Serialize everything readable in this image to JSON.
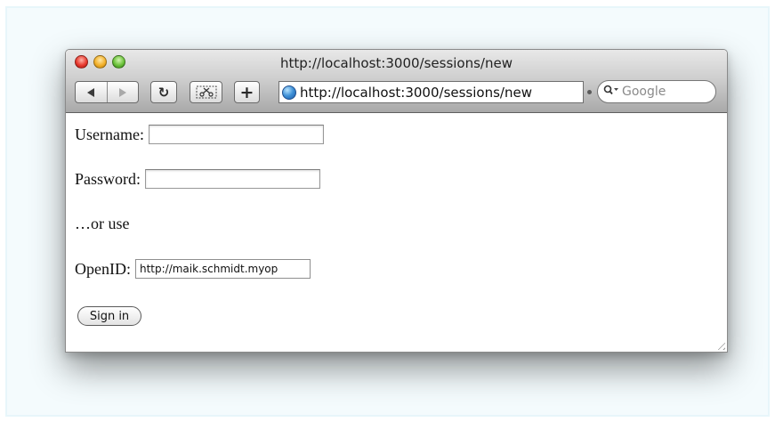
{
  "browser": {
    "window_title": "http://localhost:3000/sessions/new",
    "address_url": "http://localhost:3000/sessions/new",
    "search_placeholder": "Google",
    "toolbar": {
      "back_icon": "back-arrow-icon",
      "forward_icon": "forward-arrow-icon",
      "reload_icon": "reload-icon",
      "snip_icon": "scissors-icon",
      "add_bookmark_icon": "plus-icon",
      "reload_glyph": "↻",
      "add_glyph": "+"
    },
    "colors": {
      "close": "#e83a2f",
      "minimize": "#f3b12b",
      "zoom": "#6cc33b"
    }
  },
  "form": {
    "username_label": "Username:",
    "username_value": "",
    "password_label": "Password:",
    "password_value": "",
    "or_use_text": "…or use",
    "openid_label": "OpenID:",
    "openid_value": "http://maik.schmidt.myop",
    "submit_label": "Sign in"
  }
}
